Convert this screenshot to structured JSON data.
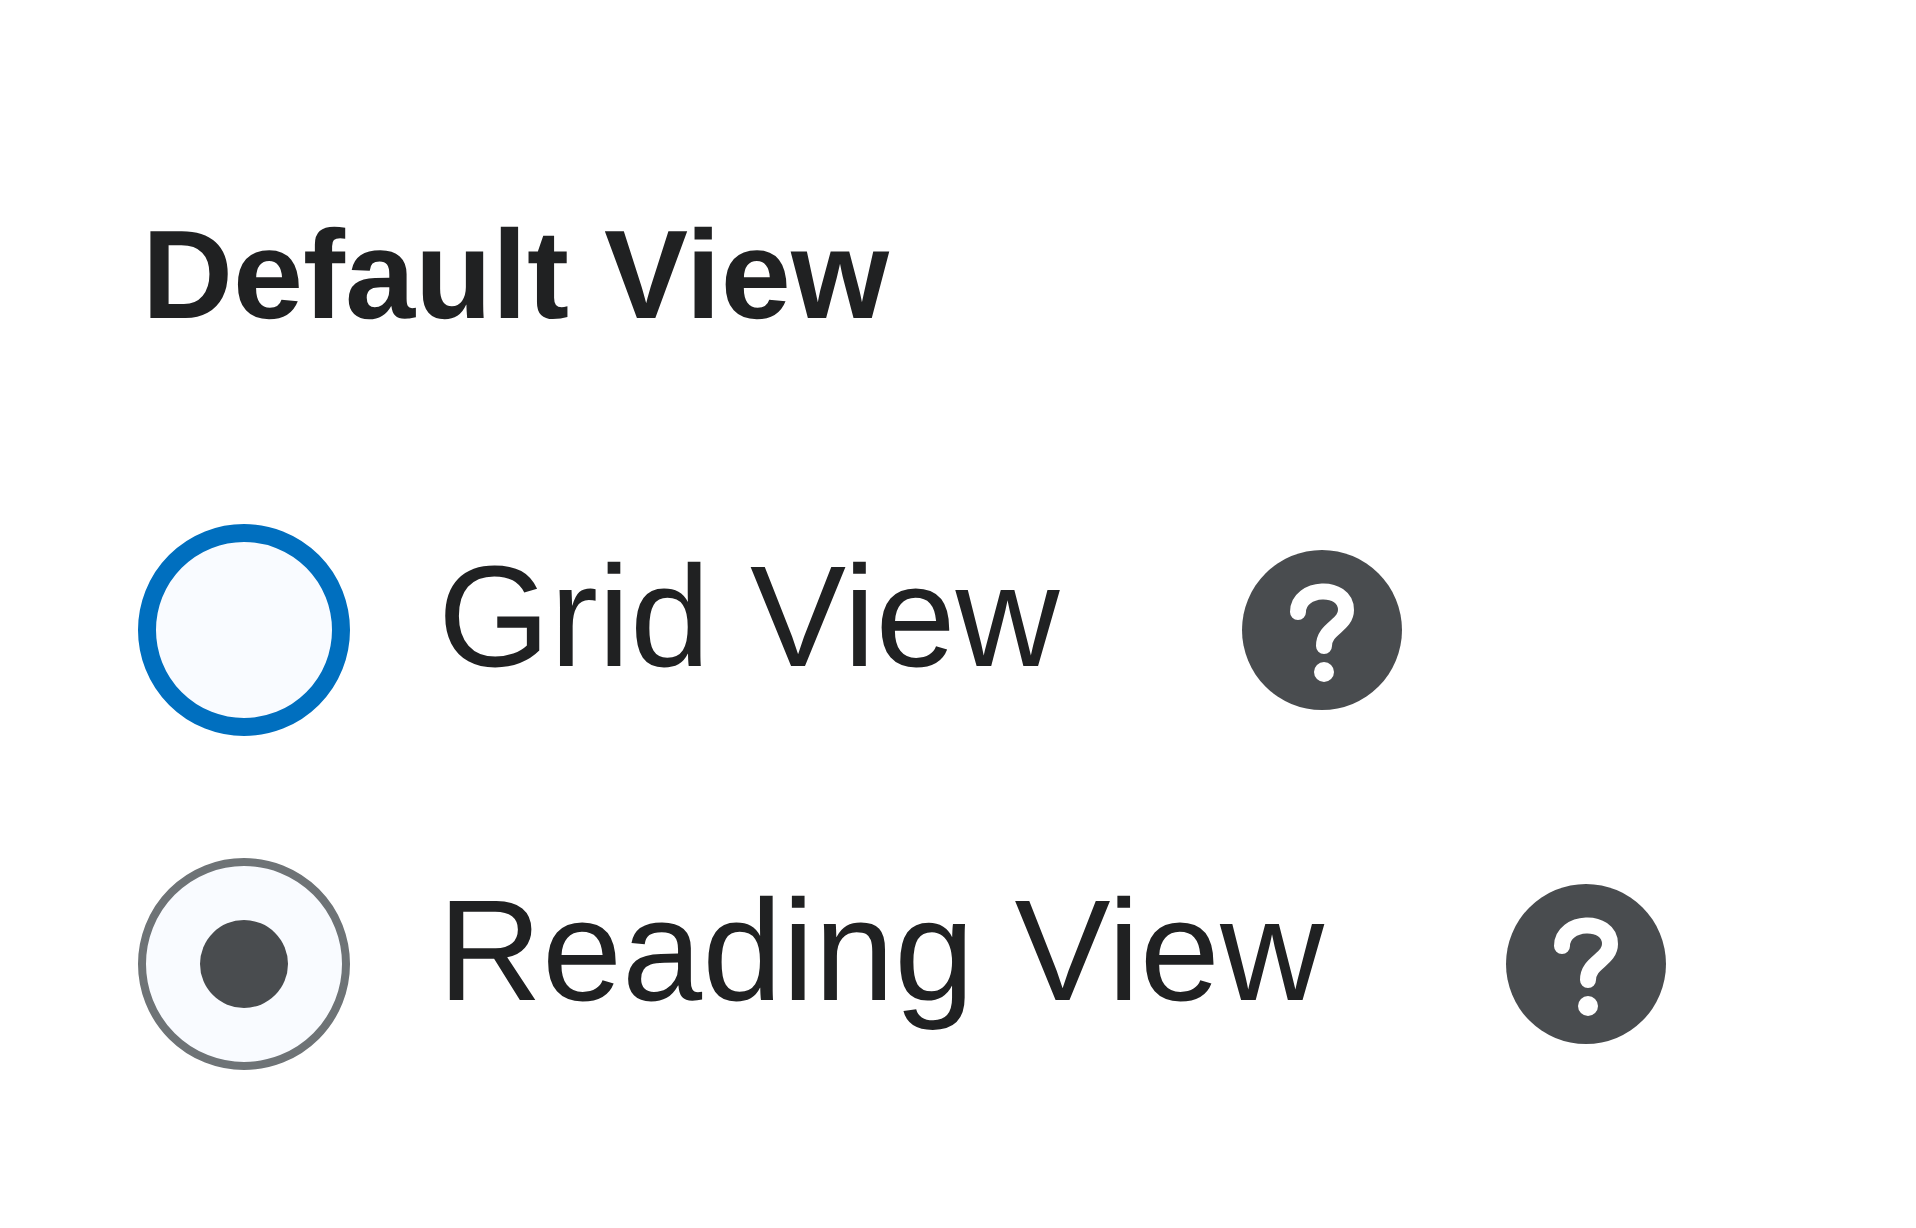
{
  "heading": "Default View",
  "options": [
    {
      "label": "Grid View",
      "selected": false,
      "focused": true
    },
    {
      "label": "Reading View",
      "selected": true,
      "focused": false
    }
  ]
}
